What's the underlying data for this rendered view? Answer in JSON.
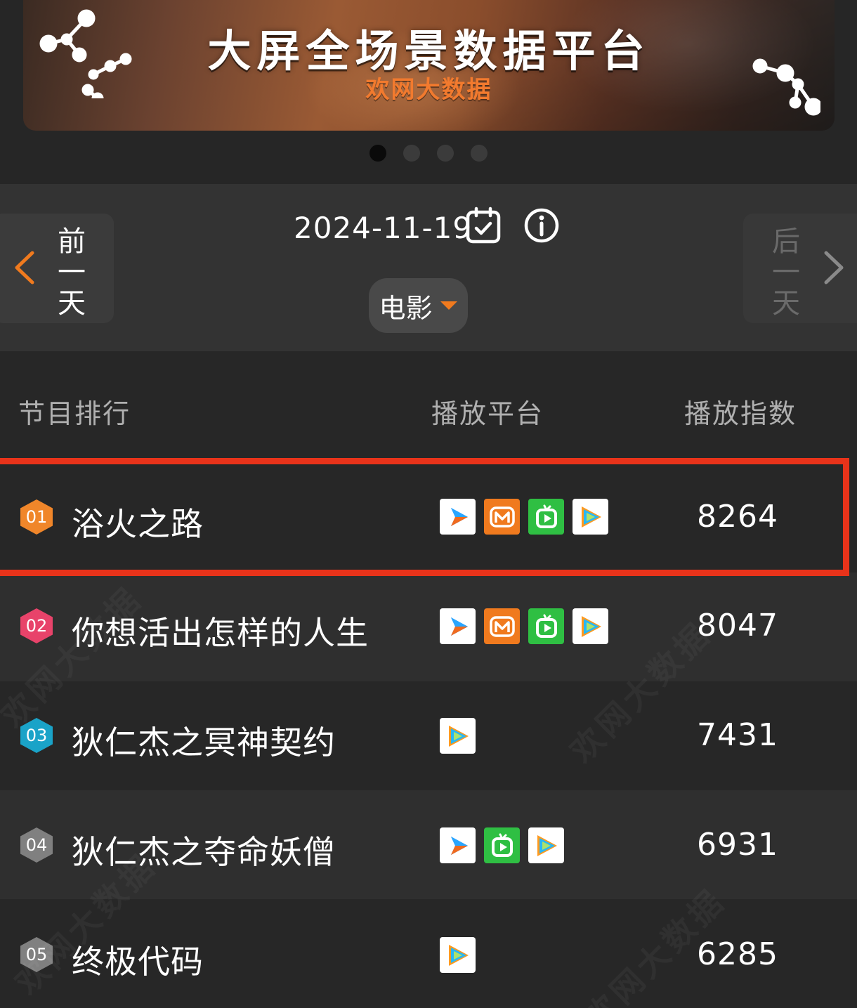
{
  "banner": {
    "title": "大屏全场景数据平台",
    "subtitle": "欢网大数据",
    "carousel_pages": 4,
    "active_page": 1
  },
  "date_nav": {
    "prev_label": [
      "前",
      "一",
      "天"
    ],
    "next_label": [
      "后",
      "一",
      "天"
    ],
    "date": "2024-11-19",
    "category": "电影"
  },
  "table": {
    "headers": {
      "rank": "节目排行",
      "platform": "播放平台",
      "index": "播放指数"
    },
    "rows": [
      {
        "rank": "01",
        "title": "浴火之路",
        "index": "8264",
        "badge_color": "#f0862a",
        "platforms": [
          "platform-a",
          "mango",
          "iqiyi",
          "tencent"
        ]
      },
      {
        "rank": "02",
        "title": "你想活出怎样的人生",
        "index": "8047",
        "badge_color": "#e8436a",
        "platforms": [
          "platform-a",
          "mango",
          "iqiyi",
          "tencent"
        ]
      },
      {
        "rank": "03",
        "title": "狄仁杰之冥神契约",
        "index": "7431",
        "badge_color": "#1aa3c8",
        "platforms": [
          "tencent"
        ]
      },
      {
        "rank": "04",
        "title": "狄仁杰之夺命妖僧",
        "index": "6931",
        "badge_color": "#808080",
        "platforms": [
          "platform-a",
          "iqiyi",
          "tencent"
        ]
      },
      {
        "rank": "05",
        "title": "终极代码",
        "index": "6285",
        "badge_color": "#808080",
        "platforms": [
          "tencent"
        ]
      }
    ]
  },
  "watermark": "欢网大数据",
  "colors": {
    "accent": "#f07a1e",
    "highlight_border": "#e8331a"
  }
}
